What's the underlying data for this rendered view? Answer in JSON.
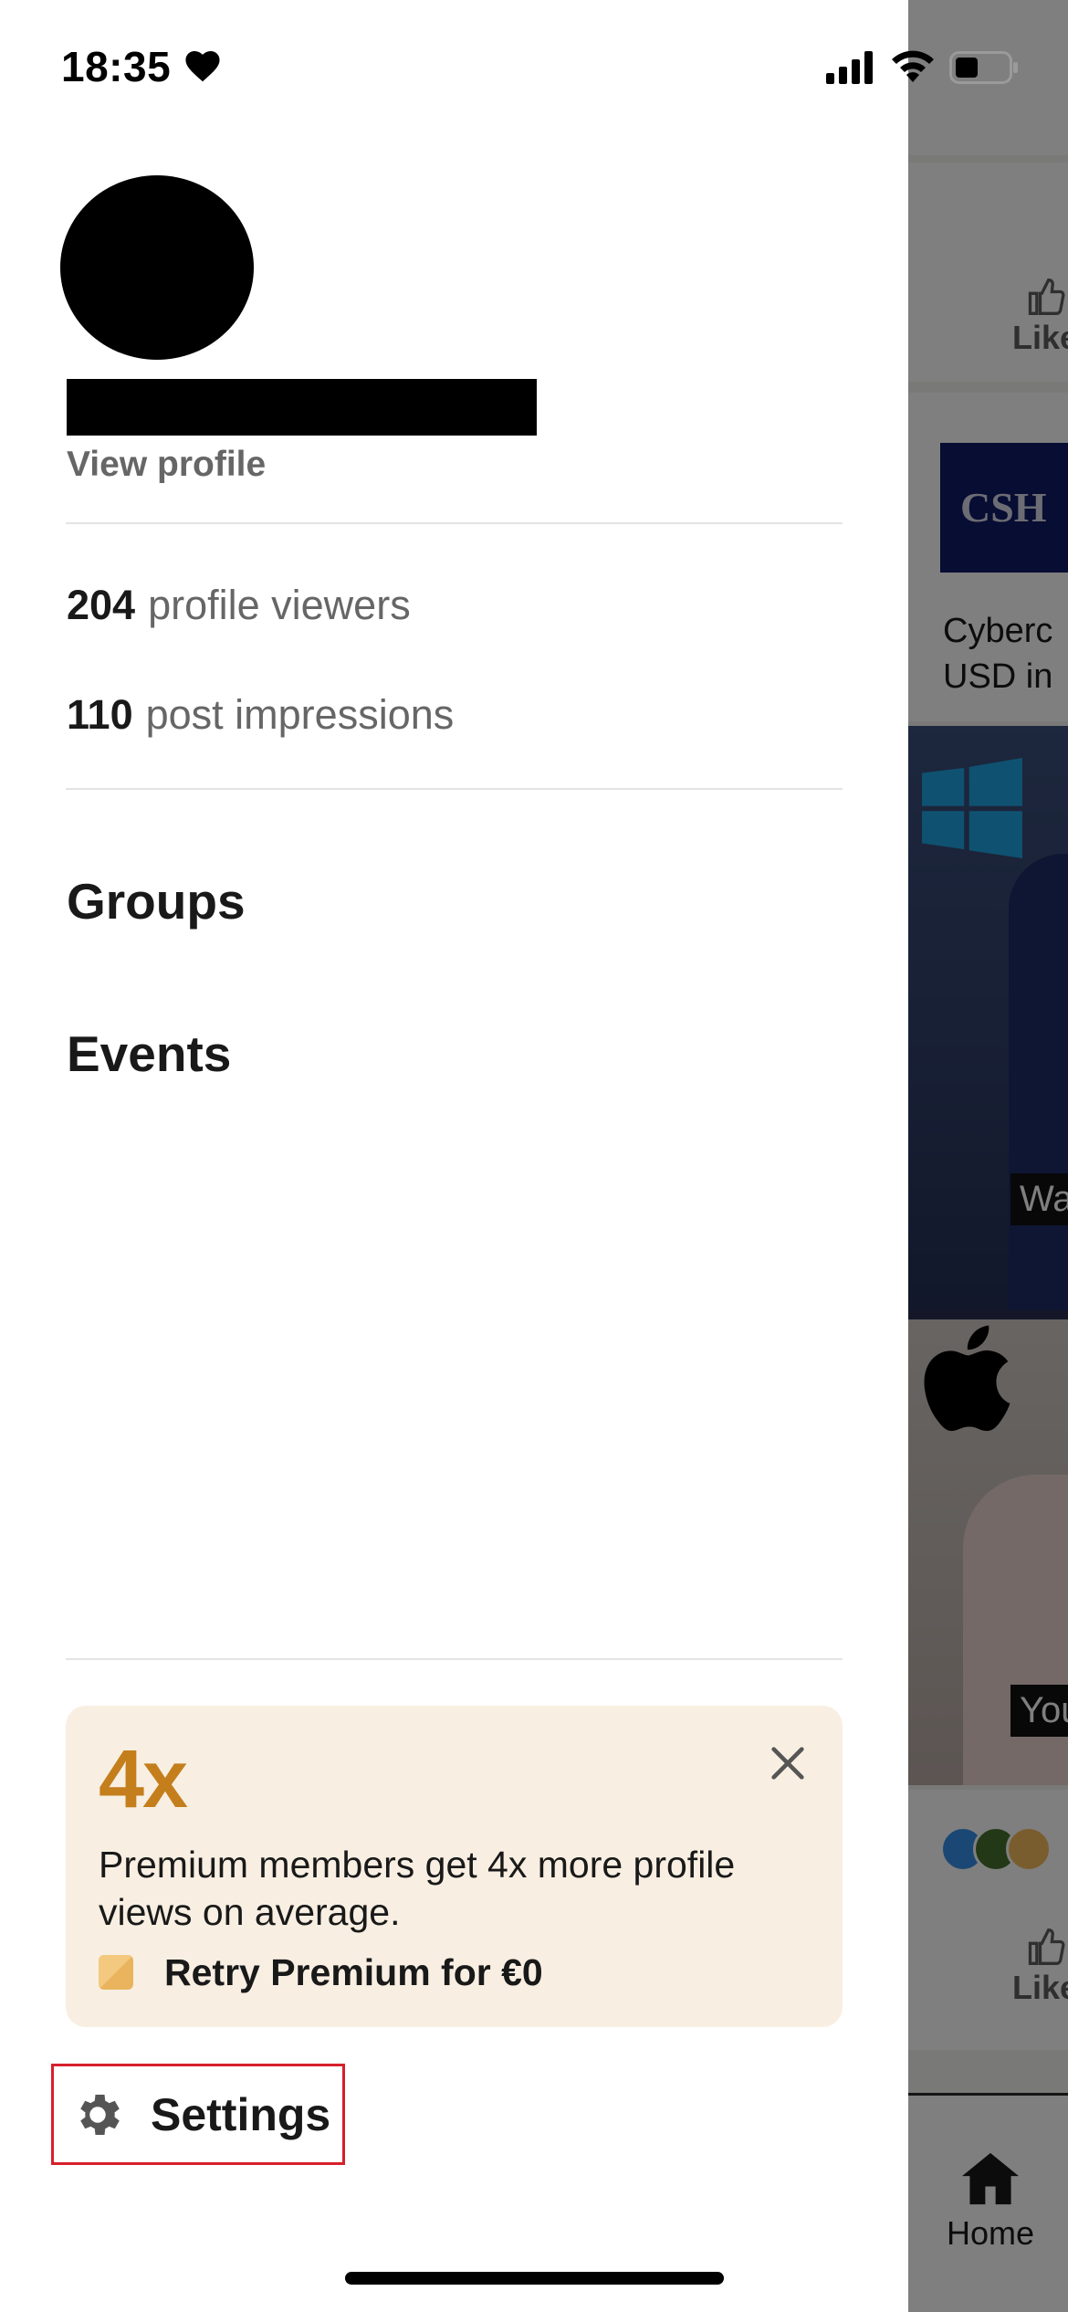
{
  "status_bar": {
    "time": "18:35"
  },
  "drawer": {
    "view_profile": "View profile",
    "stats": [
      {
        "value": "204",
        "label": "profile viewers"
      },
      {
        "value": "110",
        "label": "post impressions"
      }
    ],
    "nav": [
      {
        "label": "Groups"
      },
      {
        "label": "Events"
      }
    ],
    "promo": {
      "headline": "4x",
      "body": "Premium members get 4x more profile views on average.",
      "cta": "Retry Premium for €0"
    },
    "settings_label": "Settings"
  },
  "background_feed": {
    "like_label_1": "Like",
    "card_logo_text": "CSH",
    "post_text_line1": "Cyberc",
    "post_text_line2": "USD in",
    "caption_1": "Wa",
    "caption_2": "You",
    "like_label_2": "Like",
    "tab_home": "Home"
  },
  "colors": {
    "promo_accent": "#c47e1c",
    "promo_bg": "#f8efe2",
    "settings_highlight": "#d6202c"
  }
}
